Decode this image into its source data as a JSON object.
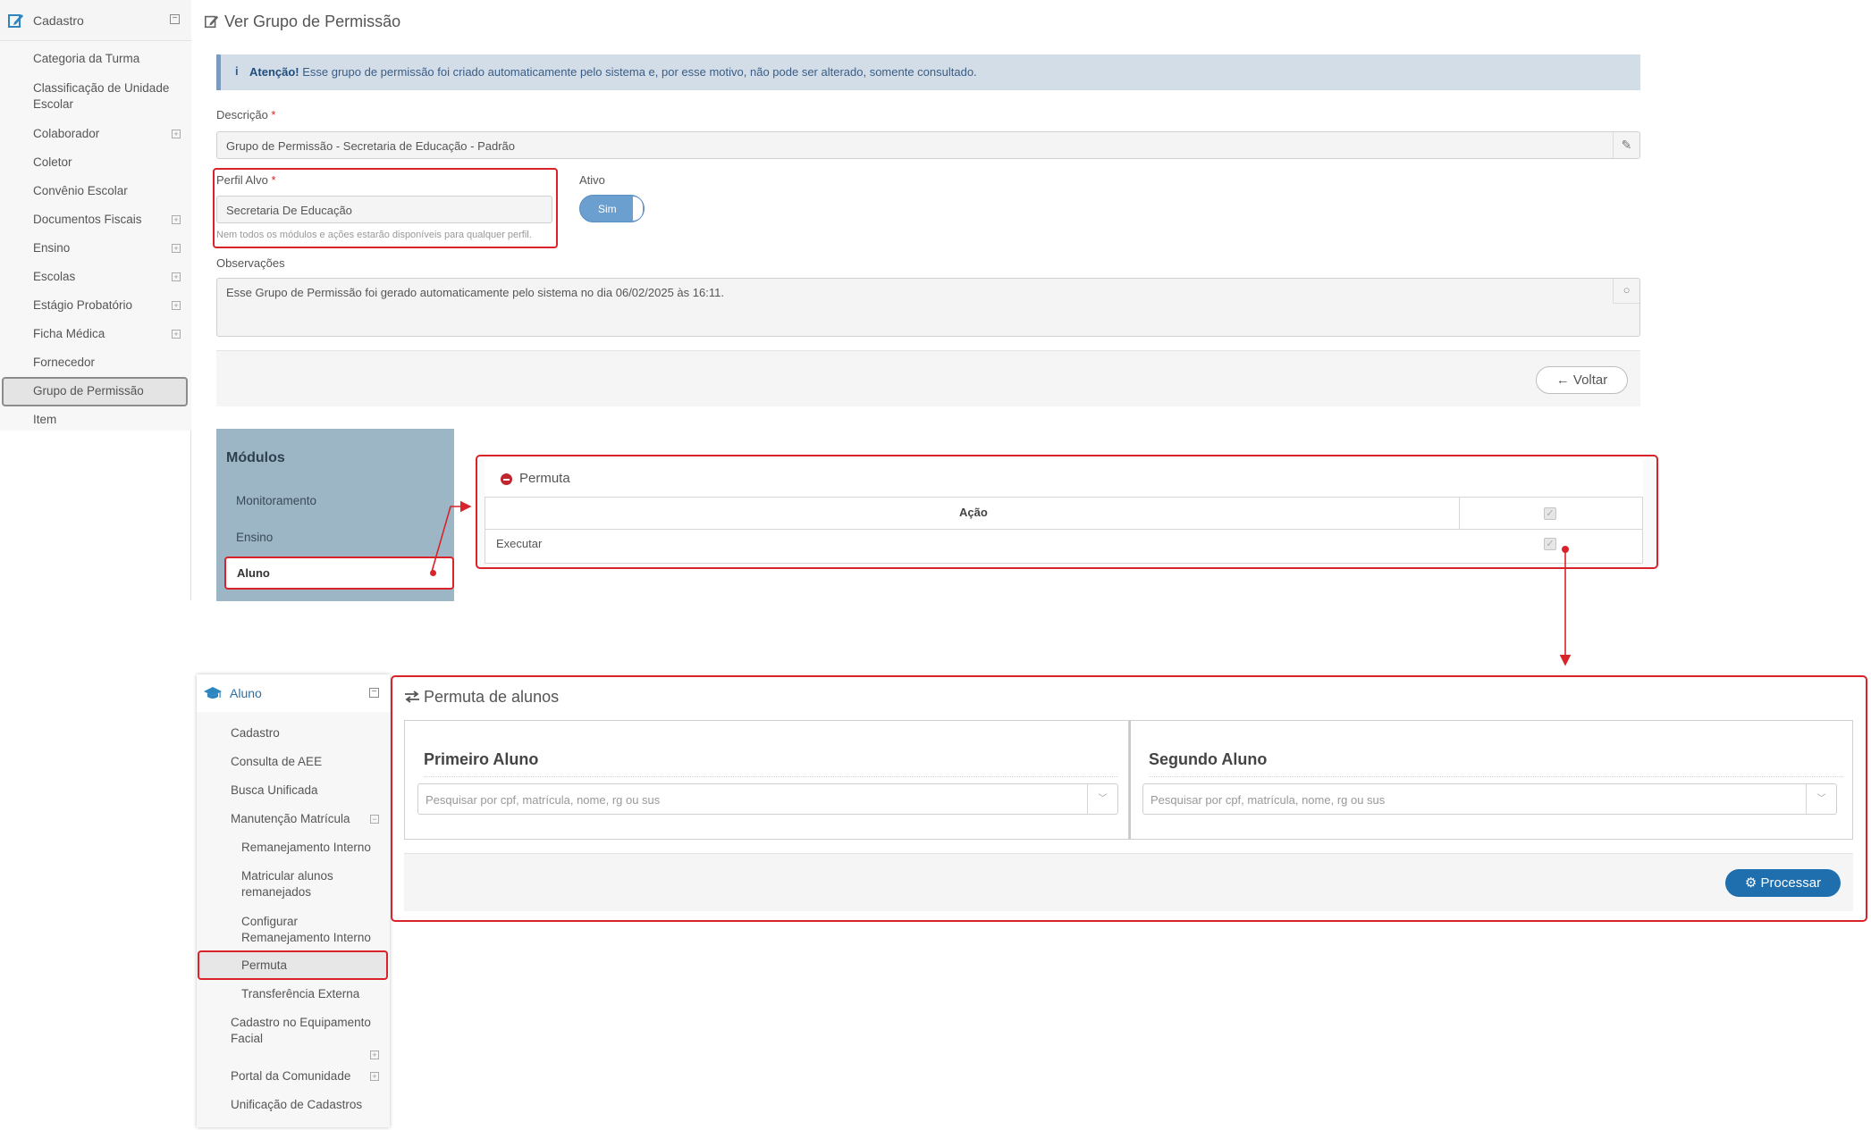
{
  "sidebar_cadastro": {
    "title": "Cadastro",
    "toggle": "⊟",
    "items": [
      {
        "label": "Categoria da Turma",
        "expandable": false
      },
      {
        "label": "Classificação de Unidade Escolar",
        "expandable": false
      },
      {
        "label": "Colaborador",
        "expandable": true
      },
      {
        "label": "Coletor",
        "expandable": false
      },
      {
        "label": "Convênio Escolar",
        "expandable": false
      },
      {
        "label": "Documentos Fiscais",
        "expandable": true
      },
      {
        "label": "Ensino",
        "expandable": true
      },
      {
        "label": "Escolas",
        "expandable": true
      },
      {
        "label": "Estágio Probatório",
        "expandable": true
      },
      {
        "label": "Ficha Médica",
        "expandable": true
      },
      {
        "label": "Fornecedor",
        "expandable": false
      },
      {
        "label": "Grupo de Permissão",
        "expandable": false,
        "active": true
      },
      {
        "label": "Item",
        "expandable": false
      }
    ]
  },
  "page": {
    "title": "Ver Grupo de Permissão"
  },
  "alert": {
    "icon": "info-icon",
    "strong": "Atenção!",
    "text": " Esse grupo de permissão foi criado automaticamente pelo sistema e, por esse motivo, não pode ser alterado, somente consultado."
  },
  "form": {
    "descricao_label": "Descrição",
    "descricao_value": "Grupo de Permissão - Secretaria de Educação - Padrão",
    "perfil_label": "Perfil Alvo",
    "perfil_value": "Secretaria De Educação",
    "perfil_hint": "Nem todos os módulos e ações estarão disponíveis para qualquer perfil.",
    "ativo_label": "Ativo",
    "ativo_value": "Sim",
    "required_mark": "*",
    "observacoes_label": "Observações",
    "observacoes_value": "Esse Grupo de Permissão foi gerado automaticamente pelo sistema no dia 06/02/2025 às 16:11.",
    "voltar_label": "Voltar",
    "voltar_icon": "←"
  },
  "modulos": {
    "title": "Módulos",
    "items": [
      "Monitoramento",
      "Ensino",
      "Aluno"
    ],
    "active": "Aluno"
  },
  "permuta_table": {
    "title": "Permuta",
    "header_acao": "Ação",
    "rows": [
      {
        "acao": "Executar",
        "checked": true
      }
    ]
  },
  "sidebar_aluno": {
    "title": "Aluno",
    "toggle": "⊟",
    "items": [
      {
        "label": "Cadastro",
        "level": 1
      },
      {
        "label": "Consulta de AEE",
        "level": 1
      },
      {
        "label": "Busca Unificada",
        "level": 1
      },
      {
        "label": "Manutenção Matrícula",
        "level": 1,
        "expandable": true
      },
      {
        "label": "Remanejamento Interno",
        "level": 2
      },
      {
        "label": "Matricular alunos remanejados",
        "level": 2
      },
      {
        "label": "Configurar Remanejamento Interno",
        "level": 2
      },
      {
        "label": "Permuta",
        "level": 2,
        "active": true
      },
      {
        "label": "Transferência Externa",
        "level": 2
      },
      {
        "label": "Cadastro no Equipamento Facial",
        "level": 1,
        "expandable": true
      },
      {
        "label": "Portal da Comunidade",
        "level": 1,
        "expandable": true
      },
      {
        "label": "Unificação de Cadastros",
        "level": 1
      }
    ]
  },
  "permuta_alunos": {
    "title": "Permuta de alunos",
    "first_heading": "Primeiro Aluno",
    "second_heading": "Segundo Aluno",
    "search_placeholder": "Pesquisar por cpf, matrícula, nome, rg ou sus",
    "processar_label": "Processar",
    "processar_icon": "gear-icon"
  },
  "colors": {
    "highlight": "#d9232a",
    "primary": "#1f6fae",
    "modulos_bg": "#9cb6c6",
    "toggle_on": "#6a9fcf",
    "alert_bg": "#d3dde8"
  }
}
